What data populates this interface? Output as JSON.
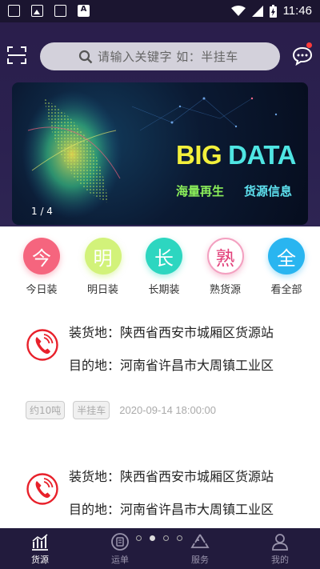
{
  "status_bar": {
    "time": "11:46"
  },
  "search": {
    "placeholder": "请输入关键字 如：半挂车"
  },
  "banner": {
    "title_big": "BIG",
    "title_data": "DATA",
    "sub_left": "海量再生",
    "sub_right": "货源信息",
    "page_indicator": "1 / 4"
  },
  "categories": [
    {
      "char": "今",
      "label": "今日装",
      "color": "#f5657e"
    },
    {
      "char": "明",
      "label": "明日装",
      "color": "#c8f06a"
    },
    {
      "char": "长",
      "label": "长期装",
      "color": "#2dd6c0"
    },
    {
      "char": "熟",
      "label": "熟货源",
      "color": "#ffffff"
    },
    {
      "char": "全",
      "label": "看全部",
      "color": "#29b5f0"
    }
  ],
  "cargo": [
    {
      "load": "装货地：陕西省西安市城厢区货源站",
      "dest": "目的地：河南省许昌市大周镇工业区",
      "weight": "约10吨",
      "vehicle": "半挂车",
      "time": "2020-09-14 18:00:00"
    },
    {
      "load": "装货地：陕西省西安市城厢区货源站",
      "dest": "目的地：河南省许昌市大周镇工业区"
    }
  ],
  "bottom_nav": [
    {
      "label": "货源",
      "icon": "chart-icon",
      "active": true
    },
    {
      "label": "运单",
      "icon": "waybill-icon",
      "active": false
    },
    {
      "label": "服务",
      "icon": "recycle-icon",
      "active": false
    },
    {
      "label": "我的",
      "icon": "user-icon",
      "active": false
    }
  ],
  "colors": {
    "header_bg": "#2a1e4b",
    "phone_red": "#e8212b",
    "nav_bg": "#221b3d"
  }
}
